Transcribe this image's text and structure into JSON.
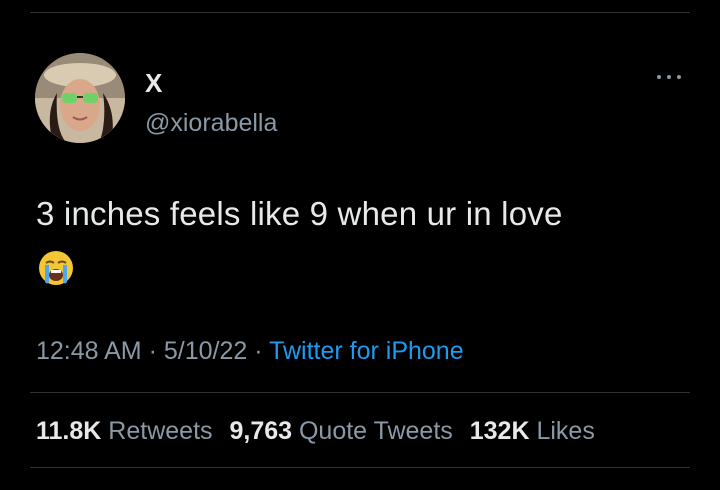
{
  "user": {
    "display_name": "X",
    "handle": "@xiorabella"
  },
  "tweet": {
    "text": "3 inches feels like 9 when ur in love",
    "emoji": "loudly-crying-face",
    "time": "12:48 AM",
    "date": "5/10/22",
    "separator": "·",
    "source": "Twitter for iPhone"
  },
  "stats": {
    "retweets_count": "11.8K",
    "retweets_label": "Retweets",
    "quote_count": "9,763",
    "quote_label": "Quote Tweets",
    "likes_count": "132K",
    "likes_label": "Likes"
  },
  "colors": {
    "background": "#000000",
    "text": "#e7e9ea",
    "secondary": "#8b98a5",
    "link": "#1d9bf0",
    "divider": "#2f3336"
  },
  "icons": {
    "more": "more-horizontal-icon",
    "emoji": "loudly-crying-face-emoji"
  }
}
